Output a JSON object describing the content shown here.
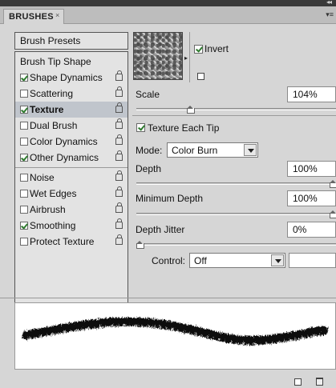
{
  "panel": {
    "tab_label": "BRUSHES",
    "close_glyph": "×",
    "collapse_glyph": "◂◂",
    "menu_glyph": "▾≡"
  },
  "left": {
    "presets_label": "Brush Presets",
    "items": [
      {
        "label": "Brush Tip Shape",
        "checkbox": false,
        "checked": false,
        "lock": false,
        "selected": false
      },
      {
        "label": "Shape Dynamics",
        "checkbox": true,
        "checked": true,
        "lock": true,
        "selected": false
      },
      {
        "label": "Scattering",
        "checkbox": true,
        "checked": false,
        "lock": true,
        "selected": false
      },
      {
        "label": "Texture",
        "checkbox": true,
        "checked": true,
        "lock": true,
        "selected": true
      },
      {
        "label": "Dual Brush",
        "checkbox": true,
        "checked": false,
        "lock": true,
        "selected": false
      },
      {
        "label": "Color Dynamics",
        "checkbox": true,
        "checked": false,
        "lock": true,
        "selected": false
      },
      {
        "label": "Other Dynamics",
        "checkbox": true,
        "checked": true,
        "lock": true,
        "selected": false
      },
      {
        "label": "Noise",
        "checkbox": true,
        "checked": false,
        "lock": true,
        "selected": false
      },
      {
        "label": "Wet Edges",
        "checkbox": true,
        "checked": false,
        "lock": true,
        "selected": false
      },
      {
        "label": "Airbrush",
        "checkbox": true,
        "checked": false,
        "lock": true,
        "selected": false
      },
      {
        "label": "Smoothing",
        "checkbox": true,
        "checked": true,
        "lock": true,
        "selected": false
      },
      {
        "label": "Protect Texture",
        "checkbox": true,
        "checked": false,
        "lock": true,
        "selected": false
      }
    ]
  },
  "texture": {
    "invert_label": "Invert",
    "invert_checked": true,
    "scale_label": "Scale",
    "scale_value": "104%",
    "scale_fraction": 0.26,
    "texture_each_tip_label": "Texture Each Tip",
    "texture_each_tip_checked": true,
    "mode_label": "Mode:",
    "mode_value": "Color Burn",
    "depth_label": "Depth",
    "depth_value": "100%",
    "depth_fraction": 1.0,
    "min_depth_label": "Minimum Depth",
    "min_depth_value": "100%",
    "min_depth_fraction": 1.0,
    "depth_jitter_label": "Depth Jitter",
    "depth_jitter_value": "0%",
    "depth_jitter_fraction": 0.0,
    "control_label": "Control:",
    "control_value": "Off",
    "control_extra_value": ""
  },
  "icons": {
    "thumb_arrow": "▸",
    "new_glyph": "",
    "trash_glyph": ""
  }
}
